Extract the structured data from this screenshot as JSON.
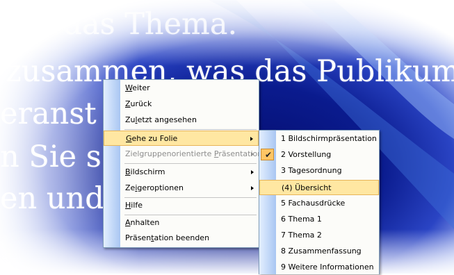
{
  "slide": {
    "lines": [
      "Sie das Thema.",
      "zusammen, was das Publikum",
      "eranst                en wird.",
      "n Sie s",
      "en und"
    ]
  },
  "context_menu": {
    "items": [
      {
        "label": "Weiter",
        "mnemonic": "W"
      },
      {
        "label": "Zurück",
        "mnemonic": "Z"
      },
      {
        "label": "Zuletzt angesehen",
        "mnemonic": "l"
      },
      {
        "label": "Gehe zu Folie",
        "mnemonic": "G",
        "submenu": true,
        "highlighted": true
      },
      {
        "label": "Zielgruppenorientierte Präsentation",
        "mnemonic": "P",
        "submenu": true,
        "disabled": true
      },
      {
        "label": "Bildschirm",
        "mnemonic": "B",
        "submenu": true
      },
      {
        "label": "Zeigeroptionen",
        "mnemonic": "i",
        "submenu": true
      },
      {
        "label": "Hilfe",
        "mnemonic": "H"
      },
      {
        "label": "Anhalten",
        "mnemonic": "A"
      },
      {
        "label": "Präsentation beenden",
        "mnemonic": "t"
      }
    ]
  },
  "slide_submenu": {
    "items": [
      {
        "label": "1 Bildschirmpräsentation"
      },
      {
        "label": "2 Vorstellung",
        "checked": true
      },
      {
        "label": "3 Tagesordnung"
      },
      {
        "label": "(4) Übersicht",
        "highlighted": true
      },
      {
        "label": "5 Fachausdrücke"
      },
      {
        "label": "6 Thema 1"
      },
      {
        "label": "7 Thema 2"
      },
      {
        "label": "8 Zusammenfassung"
      },
      {
        "label": "9 Weitere Informationen"
      }
    ]
  },
  "colors": {
    "slide_background": "#0a1b8e",
    "menu_highlight": "#ffe7a2",
    "menu_highlight_border": "#e7b458",
    "check_background": "#ffc665"
  }
}
